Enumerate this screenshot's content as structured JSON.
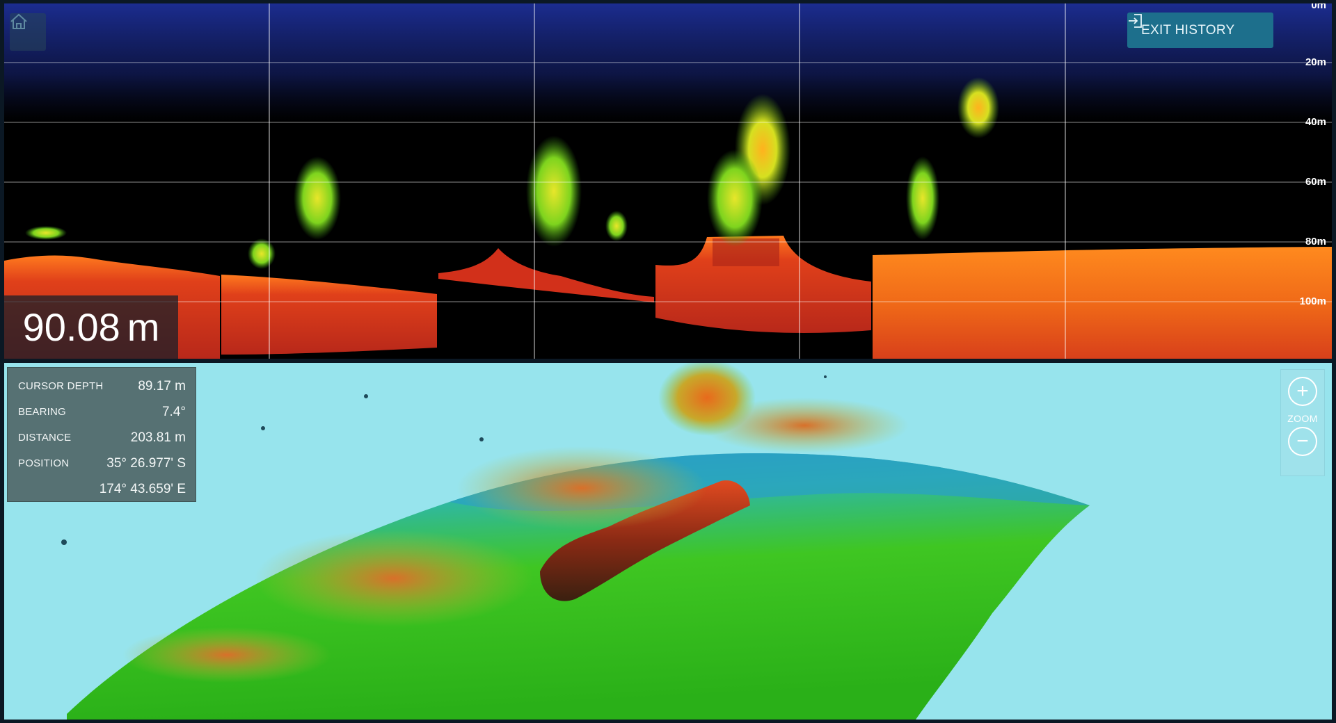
{
  "sonar": {
    "depth_scale": [
      "0m",
      "20m",
      "40m",
      "60m",
      "80m",
      "100m"
    ],
    "current_depth_value": "90.08",
    "current_depth_unit": "m",
    "exit_history_label": "EXIT HISTORY"
  },
  "info_panel": {
    "rows": [
      {
        "label": "CURSOR DEPTH",
        "value": "89.17 m"
      },
      {
        "label": "BEARING",
        "value": "7.4°"
      },
      {
        "label": "DISTANCE",
        "value": "203.81 m"
      },
      {
        "label": "POSITION",
        "value": "35° 26.977' S"
      },
      {
        "label": "",
        "value": "174° 43.659' E"
      }
    ]
  },
  "zoom": {
    "label": "ZOOM",
    "plus_symbol": "+",
    "minus_symbol": "−"
  },
  "icons": {
    "home": "home-icon",
    "exit": "exit-icon"
  },
  "colors": {
    "sonar_background": "#000000",
    "seabed_strong": "#d8301a",
    "seabed_orange": "#f0801e",
    "fish_green": "#9ad61e",
    "water_noise": "#2a3fcf",
    "view3d_background": "#97e4ed",
    "terrain_green": "#3fc622",
    "terrain_blue": "#2aa0c8",
    "info_panel_bg": "#567173",
    "exit_button_bg": "#1d6f8c"
  }
}
